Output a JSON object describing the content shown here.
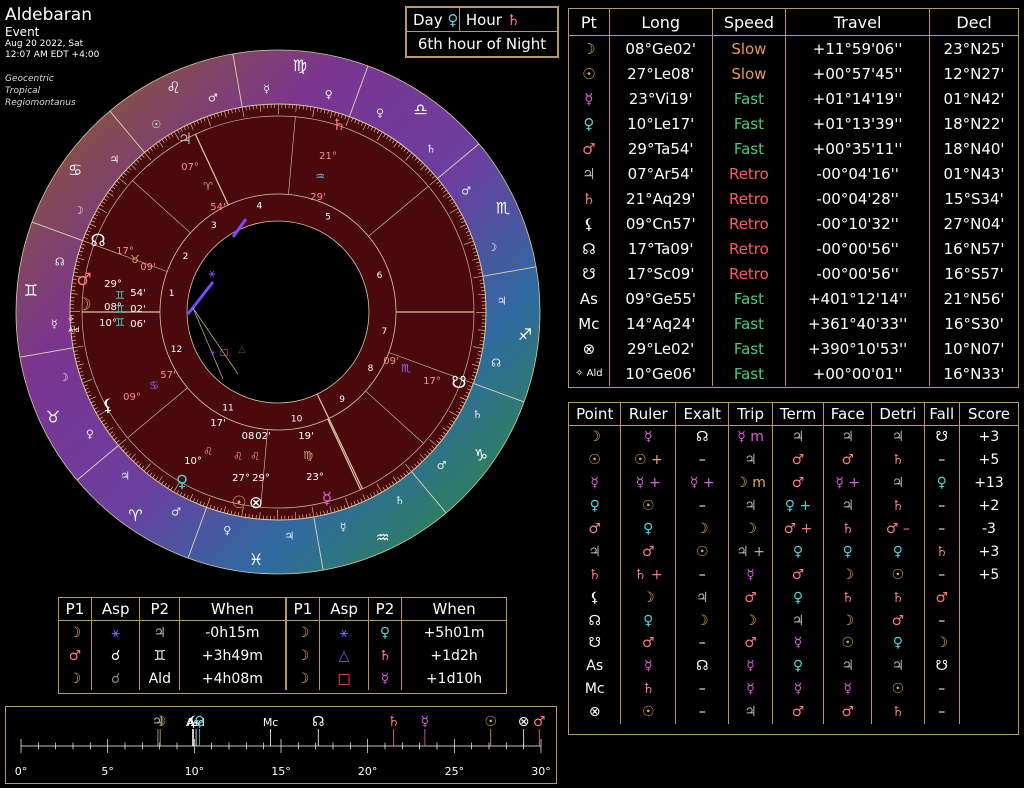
{
  "chart": {
    "title": "Aldebaran",
    "type_label": "Event",
    "date_line": "Aug 20 2022, Sat",
    "time_line": "12:07 AM EDT +4:00",
    "system": "Geocentric",
    "zodiac": "Tropical",
    "houses": "Regiomontanus"
  },
  "day_hour": {
    "day_label": "Day",
    "day_glyph": "♀",
    "hour_label": "Hour",
    "hour_glyph": "♄",
    "hour_text": "6th hour of Night"
  },
  "colors": {
    "moon": "#e5a85c",
    "sun": "#e5a85c",
    "mercury": "#e25de0",
    "venus": "#4fd1d9",
    "mars": "#ff7a7a",
    "jupiter": "#b4b4b4",
    "saturn": "#ff7a7a",
    "slow": "#e89a55",
    "fast": "#45d07a",
    "retro": "#ff5a5a",
    "border": "#b89a68",
    "chart_bg": "#4a0a0d"
  },
  "positions": {
    "headers": [
      "Pt",
      "Long",
      "Speed",
      "Travel",
      "Decl"
    ],
    "rows": [
      {
        "glyph": "☽",
        "color": "#e5a85c",
        "long": "08°Ge02'",
        "speed": "Slow",
        "speed_color": "#e89a55",
        "travel": "+11°59'06''",
        "decl": "23°N25'"
      },
      {
        "glyph": "☉",
        "color": "#e5a85c",
        "long": "27°Le08'",
        "speed": "Slow",
        "speed_color": "#e89a55",
        "travel": "+00°57'45''",
        "decl": "12°N27'"
      },
      {
        "glyph": "☿",
        "color": "#e25de0",
        "long": "23°Vi19'",
        "speed": "Fast",
        "speed_color": "#45d07a",
        "travel": "+01°14'19''",
        "decl": "01°N42'"
      },
      {
        "glyph": "♀",
        "color": "#4fd1d9",
        "long": "10°Le17'",
        "speed": "Fast",
        "speed_color": "#45d07a",
        "travel": "+01°13'39''",
        "decl": "18°N22'"
      },
      {
        "glyph": "♂",
        "color": "#ff7a7a",
        "long": "29°Ta54'",
        "speed": "Fast",
        "speed_color": "#45d07a",
        "travel": "+00°35'11''",
        "decl": "18°N40'"
      },
      {
        "glyph": "♃",
        "color": "#b4b4b4",
        "long": "07°Ar54'",
        "speed": "Retro",
        "speed_color": "#ff5a5a",
        "travel": "-00°04'16''",
        "decl": "01°N43'"
      },
      {
        "glyph": "♄",
        "color": "#ff7a7a",
        "long": "21°Aq29'",
        "speed": "Retro",
        "speed_color": "#ff5a5a",
        "travel": "-00°04'28''",
        "decl": "15°S34'"
      },
      {
        "glyph": "⚸",
        "color": "#ffffff",
        "long": "09°Cn57'",
        "speed": "Retro",
        "speed_color": "#ff5a5a",
        "travel": "-00°10'32''",
        "decl": "27°N04'"
      },
      {
        "glyph": "☊",
        "color": "#ffffff",
        "long": "17°Ta09'",
        "speed": "Retro",
        "speed_color": "#ff5a5a",
        "travel": "-00°00'56''",
        "decl": "16°N57'"
      },
      {
        "glyph": "☋",
        "color": "#ffffff",
        "long": "17°Sc09'",
        "speed": "Retro",
        "speed_color": "#ff5a5a",
        "travel": "-00°00'56''",
        "decl": "16°S57'"
      },
      {
        "glyph": "As",
        "color": "#ffffff",
        "long": "09°Ge55'",
        "speed": "Fast",
        "speed_color": "#45d07a",
        "travel": "+401°12'14''",
        "decl": "21°N56'"
      },
      {
        "glyph": "Mc",
        "color": "#ffffff",
        "long": "14°Aq24'",
        "speed": "Fast",
        "speed_color": "#45d07a",
        "travel": "+361°40'33''",
        "decl": "16°S30'"
      },
      {
        "glyph": "⊗",
        "color": "#ffffff",
        "long": "29°Le02'",
        "speed": "Fast",
        "speed_color": "#45d07a",
        "travel": "+390°10'53''",
        "decl": "10°N07'"
      },
      {
        "glyph": "✧ Ald",
        "color": "#ffffff",
        "long": "10°Ge06'",
        "speed": "Fast",
        "speed_color": "#45d07a",
        "travel": "+00°00'01''",
        "decl": "16°N33'"
      }
    ]
  },
  "dignities": {
    "headers": [
      "Point",
      "Ruler",
      "Exalt",
      "Trip",
      "Term",
      "Face",
      "Detri",
      "Fall",
      "Score"
    ],
    "rows": [
      [
        [
          "☽",
          "#e5a85c"
        ],
        [
          "☿",
          "#e25de0"
        ],
        [
          "☊",
          "#fff"
        ],
        [
          "☿ m",
          "#e25de0"
        ],
        [
          "♃",
          "#b4b4b4"
        ],
        [
          "♃",
          "#b4b4b4"
        ],
        [
          "♃",
          "#b4b4b4"
        ],
        [
          "☋",
          "#fff"
        ],
        [
          "+3",
          "#fff"
        ]
      ],
      [
        [
          "☉",
          "#e5a85c"
        ],
        [
          "☉ +",
          "#e5a85c"
        ],
        [
          "–",
          "#fff"
        ],
        [
          "♃",
          "#b4b4b4"
        ],
        [
          "♂",
          "#ff7a7a"
        ],
        [
          "♂",
          "#ff7a7a"
        ],
        [
          "♄",
          "#ff7a7a"
        ],
        [
          "–",
          "#fff"
        ],
        [
          "+5",
          "#fff"
        ]
      ],
      [
        [
          "☿",
          "#e25de0"
        ],
        [
          "☿ +",
          "#e25de0"
        ],
        [
          "☿ +",
          "#e25de0"
        ],
        [
          "☽ m",
          "#e5a85c"
        ],
        [
          "♂",
          "#ff7a7a"
        ],
        [
          "☿ +",
          "#e25de0"
        ],
        [
          "♃",
          "#b4b4b4"
        ],
        [
          "♀",
          "#4fd1d9"
        ],
        [
          "+13",
          "#fff"
        ]
      ],
      [
        [
          "♀",
          "#4fd1d9"
        ],
        [
          "☉",
          "#e5a85c"
        ],
        [
          "–",
          "#fff"
        ],
        [
          "♃",
          "#b4b4b4"
        ],
        [
          "♀ +",
          "#4fd1d9"
        ],
        [
          "♃",
          "#b4b4b4"
        ],
        [
          "♄",
          "#ff7a7a"
        ],
        [
          "–",
          "#fff"
        ],
        [
          "+2",
          "#fff"
        ]
      ],
      [
        [
          "♂",
          "#ff7a7a"
        ],
        [
          "♀",
          "#4fd1d9"
        ],
        [
          "☽",
          "#e5a85c"
        ],
        [
          "☽",
          "#e5a85c"
        ],
        [
          "♂ +",
          "#ff7a7a"
        ],
        [
          "♄",
          "#ff7a7a"
        ],
        [
          "♂ –",
          "#ff7a7a"
        ],
        [
          "–",
          "#fff"
        ],
        [
          "-3",
          "#fff"
        ]
      ],
      [
        [
          "♃",
          "#b4b4b4"
        ],
        [
          "♂",
          "#ff7a7a"
        ],
        [
          "☉",
          "#e5a85c"
        ],
        [
          "♃ +",
          "#b4b4b4"
        ],
        [
          "♀",
          "#4fd1d9"
        ],
        [
          "♀",
          "#4fd1d9"
        ],
        [
          "♀",
          "#4fd1d9"
        ],
        [
          "♄",
          "#ff7a7a"
        ],
        [
          "+3",
          "#fff"
        ]
      ],
      [
        [
          "♄",
          "#ff7a7a"
        ],
        [
          "♄ +",
          "#ff7a7a"
        ],
        [
          "–",
          "#fff"
        ],
        [
          "☿",
          "#e25de0"
        ],
        [
          "♂",
          "#ff7a7a"
        ],
        [
          "☽",
          "#e5a85c"
        ],
        [
          "☉",
          "#e5a85c"
        ],
        [
          "–",
          "#fff"
        ],
        [
          "+5",
          "#fff"
        ]
      ],
      [
        [
          "⚸",
          "#fff"
        ],
        [
          "☽",
          "#e5a85c"
        ],
        [
          "♃",
          "#b4b4b4"
        ],
        [
          "♂",
          "#ff7a7a"
        ],
        [
          "♀",
          "#4fd1d9"
        ],
        [
          "♄",
          "#ff7a7a"
        ],
        [
          "♄",
          "#ff7a7a"
        ],
        [
          "♂",
          "#ff7a7a"
        ],
        [
          "",
          "#fff"
        ]
      ],
      [
        [
          "☊",
          "#fff"
        ],
        [
          "♀",
          "#4fd1d9"
        ],
        [
          "☽",
          "#e5a85c"
        ],
        [
          "☽",
          "#e5a85c"
        ],
        [
          "♃",
          "#b4b4b4"
        ],
        [
          "☽",
          "#e5a85c"
        ],
        [
          "♂",
          "#ff7a7a"
        ],
        [
          "–",
          "#fff"
        ],
        [
          "",
          "#fff"
        ]
      ],
      [
        [
          "☋",
          "#fff"
        ],
        [
          "♂",
          "#ff7a7a"
        ],
        [
          "–",
          "#fff"
        ],
        [
          "♂",
          "#ff7a7a"
        ],
        [
          "☿",
          "#e25de0"
        ],
        [
          "☉",
          "#e5a85c"
        ],
        [
          "♀",
          "#4fd1d9"
        ],
        [
          "☽",
          "#e5a85c"
        ],
        [
          "",
          "#fff"
        ]
      ],
      [
        [
          "As",
          "#fff"
        ],
        [
          "☿",
          "#e25de0"
        ],
        [
          "☊",
          "#fff"
        ],
        [
          "☿",
          "#e25de0"
        ],
        [
          "♀",
          "#4fd1d9"
        ],
        [
          "♃",
          "#b4b4b4"
        ],
        [
          "♃",
          "#b4b4b4"
        ],
        [
          "☋",
          "#fff"
        ],
        [
          "",
          "#fff"
        ]
      ],
      [
        [
          "Mc",
          "#fff"
        ],
        [
          "♄",
          "#ff7a7a"
        ],
        [
          "–",
          "#fff"
        ],
        [
          "☿",
          "#e25de0"
        ],
        [
          "☿",
          "#e25de0"
        ],
        [
          "☿",
          "#e25de0"
        ],
        [
          "☉",
          "#e5a85c"
        ],
        [
          "–",
          "#fff"
        ],
        [
          "",
          "#fff"
        ]
      ],
      [
        [
          "⊗",
          "#fff"
        ],
        [
          "☉",
          "#e5a85c"
        ],
        [
          "–",
          "#fff"
        ],
        [
          "♃",
          "#b4b4b4"
        ],
        [
          "♂",
          "#ff7a7a"
        ],
        [
          "♂",
          "#ff7a7a"
        ],
        [
          "♄",
          "#ff7a7a"
        ],
        [
          "–",
          "#fff"
        ],
        [
          "",
          "#fff"
        ]
      ]
    ]
  },
  "aspects": {
    "headers": [
      "P1",
      "Asp",
      "P2",
      "When",
      "P1",
      "Asp",
      "P2",
      "When"
    ],
    "rows": [
      [
        [
          "☽",
          "#e5a85c"
        ],
        [
          "⚹",
          "#6a6aff"
        ],
        [
          "♃",
          "#b4b4b4"
        ],
        [
          "-0h15m",
          "#fff"
        ],
        [
          "☽",
          "#e5a85c"
        ],
        [
          "⚹",
          "#6a6aff"
        ],
        [
          "♀",
          "#4fd1d9"
        ],
        [
          "+5h01m",
          "#fff"
        ]
      ],
      [
        [
          "♂",
          "#ff7a7a"
        ],
        [
          "☌",
          "#fff"
        ],
        [
          "♊",
          "#fff"
        ],
        [
          "+3h49m",
          "#fff"
        ],
        [
          "☽",
          "#e5a85c"
        ],
        [
          "△",
          "#6a6aff"
        ],
        [
          "♄",
          "#ff7a7a"
        ],
        [
          "+1d2h",
          "#fff"
        ]
      ],
      [
        [
          "☽",
          "#e5a85c"
        ],
        [
          "☌",
          "#888"
        ],
        [
          "Ald",
          "#fff"
        ],
        [
          "+4h08m",
          "#fff"
        ],
        [
          "☽",
          "#e5a85c"
        ],
        [
          "□",
          "#ff5a5a"
        ],
        [
          "☿",
          "#e25de0"
        ],
        [
          "+1d10h",
          "#fff"
        ]
      ]
    ]
  },
  "degree_strip": {
    "scale_labels": [
      "0°",
      "5°",
      "10°",
      "15°",
      "20°",
      "25°",
      "30°"
    ],
    "markers": [
      {
        "label": "♃",
        "deg": 7.9,
        "color": "#b4b4b4"
      },
      {
        "label": "☽",
        "deg": 8.03,
        "color": "#e5a85c"
      },
      {
        "label": "As",
        "deg": 9.9,
        "color": "#fff"
      },
      {
        "label": "⚸",
        "deg": 9.95,
        "color": "#fff"
      },
      {
        "label": "Ald",
        "deg": 10.1,
        "color": "#fff"
      },
      {
        "label": "♀",
        "deg": 10.3,
        "color": "#4fd1d9"
      },
      {
        "label": "Mc",
        "deg": 14.4,
        "color": "#fff"
      },
      {
        "label": "☊",
        "deg": 17.15,
        "color": "#fff"
      },
      {
        "label": "♄",
        "deg": 21.5,
        "color": "#ff7a7a"
      },
      {
        "label": "☿",
        "deg": 23.3,
        "color": "#e25de0"
      },
      {
        "label": "☉",
        "deg": 27.1,
        "color": "#e5a85c"
      },
      {
        "label": "⊗",
        "deg": 29.0,
        "color": "#fff"
      },
      {
        "label": "♂",
        "deg": 29.9,
        "color": "#ff7a7a"
      }
    ]
  },
  "wheel": {
    "signs_ccw_from_asc": [
      "♊",
      "♉",
      "♈",
      "♓",
      "♒",
      "♑",
      "♐",
      "♏",
      "♎",
      "♍",
      "♌",
      "♋"
    ],
    "house_numbers": [
      "1",
      "2",
      "3",
      "4",
      "5",
      "6",
      "7",
      "8",
      "9",
      "10",
      "11",
      "12"
    ],
    "planets": [
      {
        "name": "moon",
        "glyph": "☽",
        "color": "#e5a85c",
        "deg": "08°",
        "min": "02'"
      },
      {
        "name": "mars",
        "glyph": "♂",
        "color": "#ff7a7a",
        "deg": "29°",
        "min": "54'"
      },
      {
        "name": "aldebaran",
        "glyph": "✧",
        "color": "#fff",
        "deg": "10°",
        "min": "06'",
        "label": "Ald"
      },
      {
        "name": "node",
        "glyph": "☊",
        "color": "#fff",
        "deg": "17°",
        "min": "09'"
      },
      {
        "name": "jupiter",
        "glyph": "♃",
        "color": "#b4b4b4",
        "deg": "07°",
        "min": "54'"
      },
      {
        "name": "saturn",
        "glyph": "♄",
        "color": "#ff7a7a",
        "deg": "21°",
        "min": "29'"
      },
      {
        "name": "south-node",
        "glyph": "☋",
        "color": "#fff",
        "deg": "17°",
        "min": "09'"
      },
      {
        "name": "mercury",
        "glyph": "☿",
        "color": "#e25de0",
        "deg": "23°",
        "min": "19'"
      },
      {
        "name": "sun",
        "glyph": "☉",
        "color": "#e5a85c",
        "deg": "27°",
        "min": "08'"
      },
      {
        "name": "fortune",
        "glyph": "⊗",
        "color": "#fff",
        "deg": "29°",
        "min": "02'"
      },
      {
        "name": "venus",
        "glyph": "♀",
        "color": "#4fd1d9",
        "deg": "10°",
        "min": "17'"
      },
      {
        "name": "lilith",
        "glyph": "⚸",
        "color": "#fff",
        "deg": "09°",
        "min": "57'"
      }
    ]
  }
}
